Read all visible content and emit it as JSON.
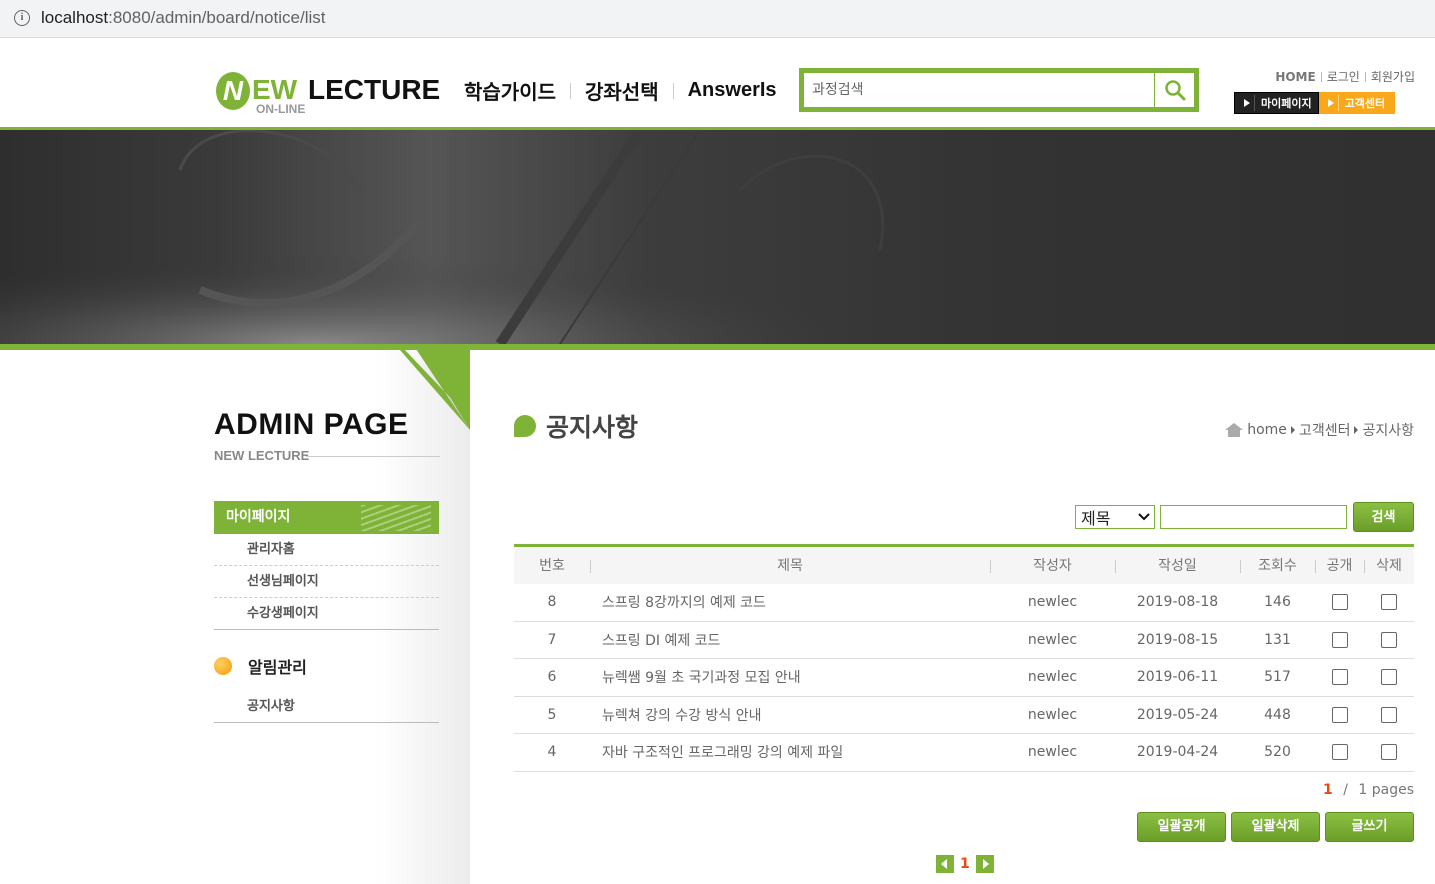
{
  "browser": {
    "url_host": "localhost",
    "url_rest": ":8080/admin/board/notice/list",
    "info_icon": "info-icon"
  },
  "header": {
    "logo": {
      "n": "N",
      "ew": "EW",
      "lecture": "LECTURE",
      "online": "ON-LINE"
    },
    "gnb": [
      "학습가이드",
      "강좌선택",
      "AnswerIs"
    ],
    "search": {
      "placeholder": "과정검색",
      "icon": "search-icon"
    },
    "util": [
      "HOME",
      "로그인",
      "회원가입"
    ],
    "quick": {
      "mypage": "마이페이지",
      "customer": "고객센터"
    }
  },
  "sidebar": {
    "title": "ADMIN PAGE",
    "subtitle": "NEW LECTURE",
    "menu_head": "마이페이지",
    "items": [
      "관리자홈",
      "선생님페이지",
      "수강생페이지"
    ],
    "section": "알림관리",
    "section_items": [
      "공지사항"
    ]
  },
  "main": {
    "title": "공지사항",
    "breadcrumb": [
      "home",
      "고객센터",
      "공지사항"
    ],
    "search": {
      "field": "제목",
      "button": "검색"
    },
    "columns": [
      "번호",
      "제목",
      "작성자",
      "작성일",
      "조회수",
      "공개",
      "삭제"
    ],
    "rows": [
      {
        "no": "8",
        "title": "스프링 8강까지의 예제 코드",
        "writer": "newlec",
        "date": "2019-08-18",
        "hit": "146"
      },
      {
        "no": "7",
        "title": "스프링 DI 예제 코드",
        "writer": "newlec",
        "date": "2019-08-15",
        "hit": "131"
      },
      {
        "no": "6",
        "title": "뉴렉쌤 9월 초 국기과정 모집 안내",
        "writer": "newlec",
        "date": "2019-06-11",
        "hit": "517"
      },
      {
        "no": "5",
        "title": "뉴렉쳐 강의 수강 방식 안내",
        "writer": "newlec",
        "date": "2019-05-24",
        "hit": "448"
      },
      {
        "no": "4",
        "title": "자바 구조적인 프로그래밍 강의 예제 파일",
        "writer": "newlec",
        "date": "2019-04-24",
        "hit": "520"
      }
    ],
    "pages": {
      "current": "1",
      "sep": "/",
      "total": "1 pages"
    },
    "buttons": {
      "open_all": "일괄공개",
      "delete_all": "일괄삭제",
      "write": "글쓰기"
    },
    "pager": {
      "page": "1"
    }
  },
  "colors": {
    "accent": "#7fb337",
    "orange": "#f7a81b",
    "page_current": "#e84a13"
  }
}
